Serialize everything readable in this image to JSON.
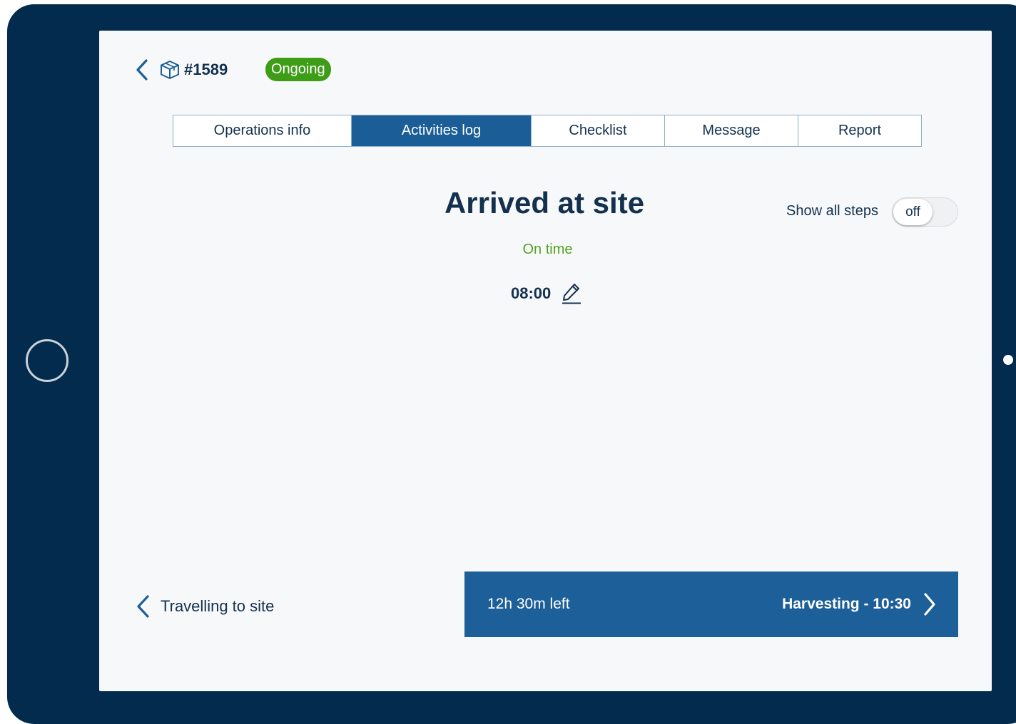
{
  "header": {
    "order_id": "#1589",
    "status": "Ongoing",
    "status_color": "#3e9d16"
  },
  "tabs": [
    {
      "label": "Operations info",
      "active": false
    },
    {
      "label": "Activities log",
      "active": true
    },
    {
      "label": "Checklist",
      "active": false
    },
    {
      "label": "Message",
      "active": false
    },
    {
      "label": "Report",
      "active": false
    }
  ],
  "step": {
    "title": "Arrived at site",
    "status": "On time",
    "status_color": "#52a320",
    "time": "08:00"
  },
  "toggle": {
    "label": "Show all steps",
    "state": "off"
  },
  "nav": {
    "previous_label": "Travelling to site",
    "time_left": "12h 30m left",
    "next_label": "Harvesting - 10:30"
  },
  "colors": {
    "device_frame": "#022b4d",
    "primary": "#1b5e97",
    "text": "#13314f"
  },
  "icons": {
    "back": "chevron-left-icon",
    "order": "package-box-icon",
    "edit": "pencil-icon",
    "previous": "chevron-left-icon",
    "next": "chevron-right-icon"
  }
}
